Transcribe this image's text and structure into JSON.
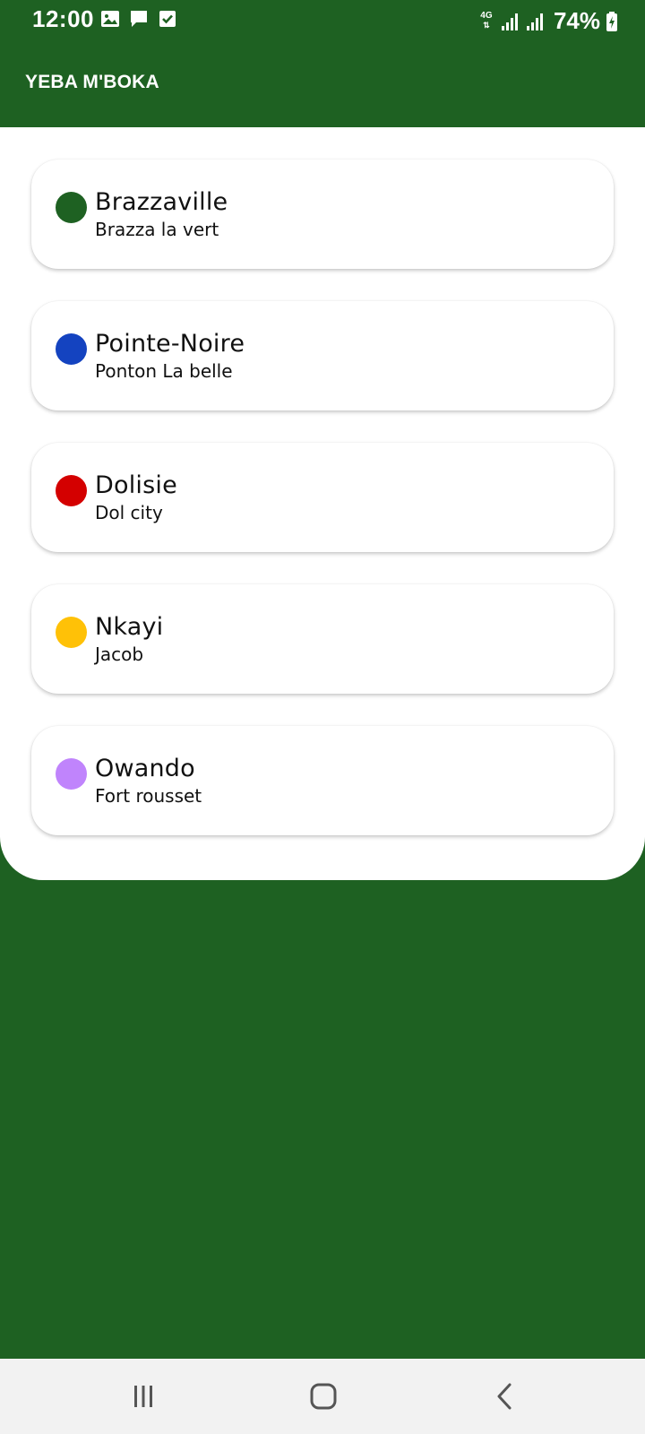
{
  "status_bar": {
    "time": "12:00",
    "notification_icons": [
      "image-icon",
      "message-icon",
      "checkbox-icon"
    ],
    "network_type": "4G",
    "battery_percent": "74%"
  },
  "app_bar": {
    "title": "YEBA M'BOKA",
    "background_color": "#1e6122"
  },
  "cities": [
    {
      "name": "Brazzaville",
      "nickname": "Brazza la vert",
      "color": "#1e6122"
    },
    {
      "name": "Pointe-Noire",
      "nickname": "Ponton La belle",
      "color": "#1443c0"
    },
    {
      "name": "Dolisie",
      "nickname": "Dol city",
      "color": "#d40000"
    },
    {
      "name": "Nkayi",
      "nickname": "Jacob",
      "color": "#ffc107"
    },
    {
      "name": "Owando",
      "nickname": "Fort rousset",
      "color": "#c084fc"
    }
  ],
  "navigation_bar": {
    "buttons": [
      "recent-apps-icon",
      "home-icon",
      "back-icon"
    ]
  }
}
